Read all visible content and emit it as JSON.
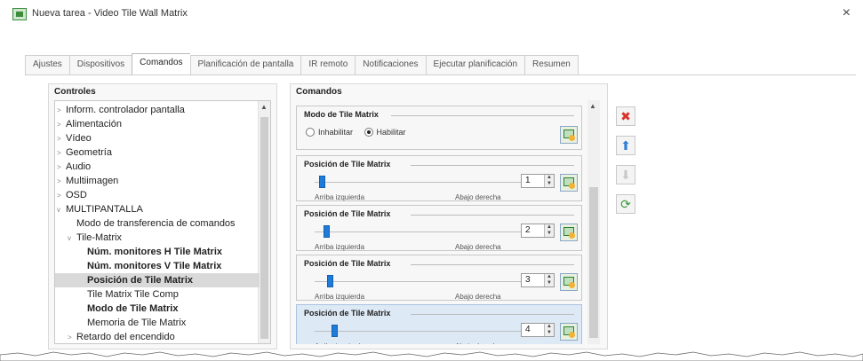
{
  "window": {
    "title": "Nueva tarea - Video Tile Wall Matrix",
    "close_glyph": "×"
  },
  "tabs": [
    {
      "label": "Ajustes"
    },
    {
      "label": "Dispositivos"
    },
    {
      "label": "Comandos",
      "active": true
    },
    {
      "label": "Planificación de pantalla"
    },
    {
      "label": "IR remoto"
    },
    {
      "label": "Notificaciones"
    },
    {
      "label": "Ejecutar planificación"
    },
    {
      "label": "Resumen"
    }
  ],
  "controls": {
    "title": "Controles",
    "items": [
      {
        "label": "Inform. controlador pantalla",
        "arrow": ">",
        "level": 0
      },
      {
        "label": "Alimentación",
        "arrow": ">",
        "level": 0
      },
      {
        "label": "Vídeo",
        "arrow": ">",
        "level": 0
      },
      {
        "label": "Geometría",
        "arrow": ">",
        "level": 0
      },
      {
        "label": "Audio",
        "arrow": ">",
        "level": 0
      },
      {
        "label": "Multiimagen",
        "arrow": ">",
        "level": 0
      },
      {
        "label": "OSD",
        "arrow": ">",
        "level": 0
      },
      {
        "label": "MULTIPANTALLA",
        "arrow": "v",
        "level": 0
      },
      {
        "label": "Modo de transferencia de comandos",
        "arrow": "",
        "level": 1
      },
      {
        "label": "Tile-Matrix",
        "arrow": "v",
        "level": 1
      },
      {
        "label": "Núm. monitores H Tile Matrix",
        "arrow": "",
        "level": 2,
        "bold": true
      },
      {
        "label": "Núm. monitores V Tile Matrix",
        "arrow": "",
        "level": 2,
        "bold": true
      },
      {
        "label": "Posición de Tile Matrix",
        "arrow": "",
        "level": 2,
        "bold": true,
        "selected": true
      },
      {
        "label": "Tile Matrix Tile Comp",
        "arrow": "",
        "level": 2
      },
      {
        "label": "Modo de Tile Matrix",
        "arrow": "",
        "level": 2,
        "bold": true
      },
      {
        "label": "Memoria de Tile Matrix",
        "arrow": "",
        "level": 2
      },
      {
        "label": "Retardo del encendido",
        "arrow": ">",
        "level": 1
      }
    ]
  },
  "commands": {
    "title": "Comandos",
    "mode_group": {
      "title": "Modo de Tile Matrix",
      "options": [
        {
          "label": "Inhabilitar",
          "checked": false
        },
        {
          "label": "Habilitar",
          "checked": true
        }
      ]
    },
    "position_groups": [
      {
        "title": "Posición de Tile Matrix",
        "value": "1",
        "min_label": "Arriba izquierda",
        "max_label": "Abajo derecha",
        "level": 0.02
      },
      {
        "title": "Posición de Tile Matrix",
        "value": "2",
        "min_label": "Arriba izquierda",
        "max_label": "Abajo derecha",
        "level": 0.04
      },
      {
        "title": "Posición de Tile Matrix",
        "value": "3",
        "min_label": "Arriba izquierda",
        "max_label": "Abajo derecha",
        "level": 0.06
      },
      {
        "title": "Posición de Tile Matrix",
        "value": "4",
        "min_label": "Arriba izquierda",
        "max_label": "Abajo derecha",
        "level": 0.08,
        "active": true
      }
    ]
  },
  "side_actions": [
    {
      "name": "delete-icon",
      "glyph": "✖",
      "color": "#d9342b"
    },
    {
      "name": "move-up-icon",
      "glyph": "⬆",
      "color": "#2e7fd6"
    },
    {
      "name": "move-down-icon",
      "glyph": "⬇",
      "color": "#c9c9c9"
    },
    {
      "name": "refresh-icon",
      "glyph": "⟳",
      "color": "#3a9a3a"
    }
  ]
}
